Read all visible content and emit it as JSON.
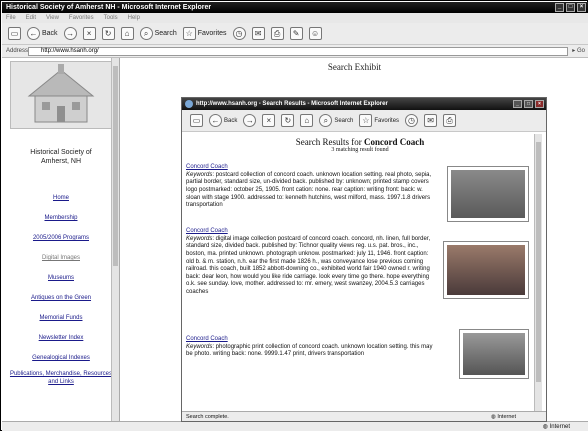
{
  "window": {
    "title": "Historical Society of Amherst NH - Microsoft Internet Explorer"
  },
  "menu": [
    "File",
    "Edit",
    "View",
    "Favorites",
    "Tools",
    "Help"
  ],
  "toolbar": {
    "back": "Back",
    "search": "Search",
    "favorites": "Favorites"
  },
  "address": {
    "label": "Address",
    "url": "http://www.hsanh.org/",
    "go": "Go"
  },
  "sidebar": {
    "title_line1": "Historical Society of",
    "title_line2": "Amherst, NH",
    "items": [
      {
        "label": "Home"
      },
      {
        "label": "Membership"
      },
      {
        "label": "2005/2006 Programs"
      },
      {
        "label": "Digital Images"
      },
      {
        "label": "Museums"
      },
      {
        "label": "Antiques on the Green"
      },
      {
        "label": "Memorial Funds"
      },
      {
        "label": "Newsletter Index"
      },
      {
        "label": "Genealogical Indexes"
      },
      {
        "label": "Publications, Merchandise, Resources and Links"
      }
    ]
  },
  "main": {
    "heading": "Search Exhibit"
  },
  "status": {
    "zone": "Internet"
  },
  "popup": {
    "title": "http://www.hsanh.org - Search Results - Microsoft Internet Explorer",
    "toolbar": {
      "back": "Back",
      "search": "Search",
      "favorites": "Favorites"
    },
    "heading_prefix": "Search Results for ",
    "heading_term": "Concord Coach",
    "count": "3 matching result found",
    "results": [
      {
        "title": "Concord Coach",
        "keywords_label": "Keywords",
        "text": ": postcard collection of concord coach. unknown location setting. real photo, sepia, partial border, standard size, un-divided back. published by: unknown; printed stamp covers logo postmarked: october 25, 1905. front cation: none. rear caption: writing front: back: w. sloan with stage 1900. addressed to: kenneth hutchins, west milford, mass. 1997.1.8 drivers transportation"
      },
      {
        "title": "Concord Coach",
        "keywords_label": "Keywords",
        "text": ": digital image collection postcard of concord coach. concord, nh. linen, full border, standard size, divided back. published by: Tichnor quality views reg. u.s. pat. bros., inc., boston, ma. printed unknown. photograph unknow. postmarked: july 11, 1946. front caption: old b. & m. station, n.h. ear the first made 1826 h., was conveyance lose previous coming railroad. this coach, built 1852 abbott-downing co., exhibited world fair 1940 owned r. writing back: dear leon, how would you like ride carriage. look every time go there. hope everything o.k. see sunday. love, mother. addressed to: mr. emery, west swanzey, 2004.5.3 carriages coaches"
      },
      {
        "title": "Concord Coach",
        "keywords_label": "Keywords",
        "text": ": photographic print collection of concord coach. unknown location setting. this may be photo. writing back: none. 9999.1.47 print, drivers transportation"
      }
    ],
    "status_text": "Search complete.",
    "zone": "Internet"
  }
}
